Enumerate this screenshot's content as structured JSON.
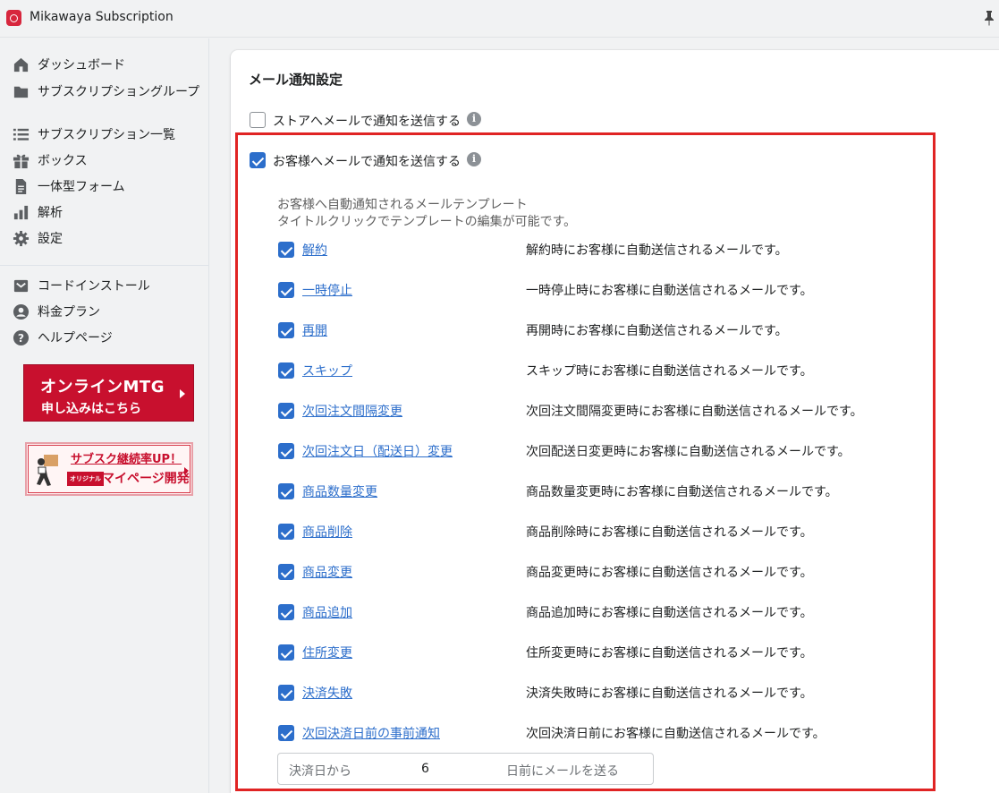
{
  "app": {
    "title": "Mikawaya Subscription"
  },
  "sidebar": {
    "items": [
      {
        "label": "ダッシュボード",
        "icon": "home-icon"
      },
      {
        "label": "サブスクリプショングループ",
        "icon": "folder-icon"
      },
      {
        "label": "サブスクリプション一覧",
        "icon": "list-icon"
      },
      {
        "label": "ボックス",
        "icon": "gift-icon"
      },
      {
        "label": "一体型フォーム",
        "icon": "document-icon"
      },
      {
        "label": "解析",
        "icon": "bar-chart-icon"
      },
      {
        "label": "設定",
        "icon": "gear-icon"
      }
    ],
    "items2": [
      {
        "label": "コードインストール",
        "icon": "code-icon"
      },
      {
        "label": "料金プラン",
        "icon": "user-circle-icon"
      },
      {
        "label": "ヘルプページ",
        "icon": "question-icon"
      }
    ],
    "banner_mtg": {
      "line1": "オンラインMTG",
      "line2": "申し込みはこちら"
    },
    "banner_sub": {
      "line1": "サブスク継続率UP！",
      "tag": "オリジナル",
      "line2": "マイページ開発"
    }
  },
  "settings": {
    "title": "メール通知設定",
    "store_notify": {
      "label": "ストアへメールで通知を送信する",
      "checked": false
    },
    "customer_notify": {
      "label": "お客様へメールで通知を送信する",
      "checked": true
    },
    "template_desc1": "お客様へ自動通知されるメールテンプレート",
    "template_desc2": "タイトルクリックでテンプレートの編集が可能です。",
    "templates": [
      {
        "name": "解約",
        "desc": "解約時にお客様に自動送信されるメールです。",
        "checked": true
      },
      {
        "name": "一時停止",
        "desc": "一時停止時にお客様に自動送信されるメールです。",
        "checked": true
      },
      {
        "name": "再開",
        "desc": "再開時にお客様に自動送信されるメールです。",
        "checked": true
      },
      {
        "name": "スキップ",
        "desc": "スキップ時にお客様に自動送信されるメールです。",
        "checked": true
      },
      {
        "name": "次回注文間隔変更",
        "desc": "次回注文間隔変更時にお客様に自動送信されるメールです。",
        "checked": true
      },
      {
        "name": "次回注文日（配送日）変更",
        "desc": "次回配送日変更時にお客様に自動送信されるメールです。",
        "checked": true
      },
      {
        "name": "商品数量変更",
        "desc": "商品数量変更時にお客様に自動送信されるメールです。",
        "checked": true
      },
      {
        "name": "商品削除",
        "desc": "商品削除時にお客様に自動送信されるメールです。",
        "checked": true
      },
      {
        "name": "商品変更",
        "desc": "商品変更時にお客様に自動送信されるメールです。",
        "checked": true
      },
      {
        "name": "商品追加",
        "desc": "商品追加時にお客様に自動送信されるメールです。",
        "checked": true
      },
      {
        "name": "住所変更",
        "desc": "住所変更時にお客様に自動送信されるメールです。",
        "checked": true
      },
      {
        "name": "決済失敗",
        "desc": "決済失敗時にお客様に自動送信されるメールです。",
        "checked": true
      },
      {
        "name": "次回決済日前の事前通知",
        "desc": "次回決済日前にお客様に自動送信されるメールです。",
        "checked": true
      }
    ],
    "days_field": {
      "prefix": "決済日から",
      "value": "6",
      "suffix": "日前にメールを送る"
    }
  },
  "colors": {
    "accent": "#2c6ecb",
    "highlight": "#e02424",
    "banner": "#c8102e"
  }
}
